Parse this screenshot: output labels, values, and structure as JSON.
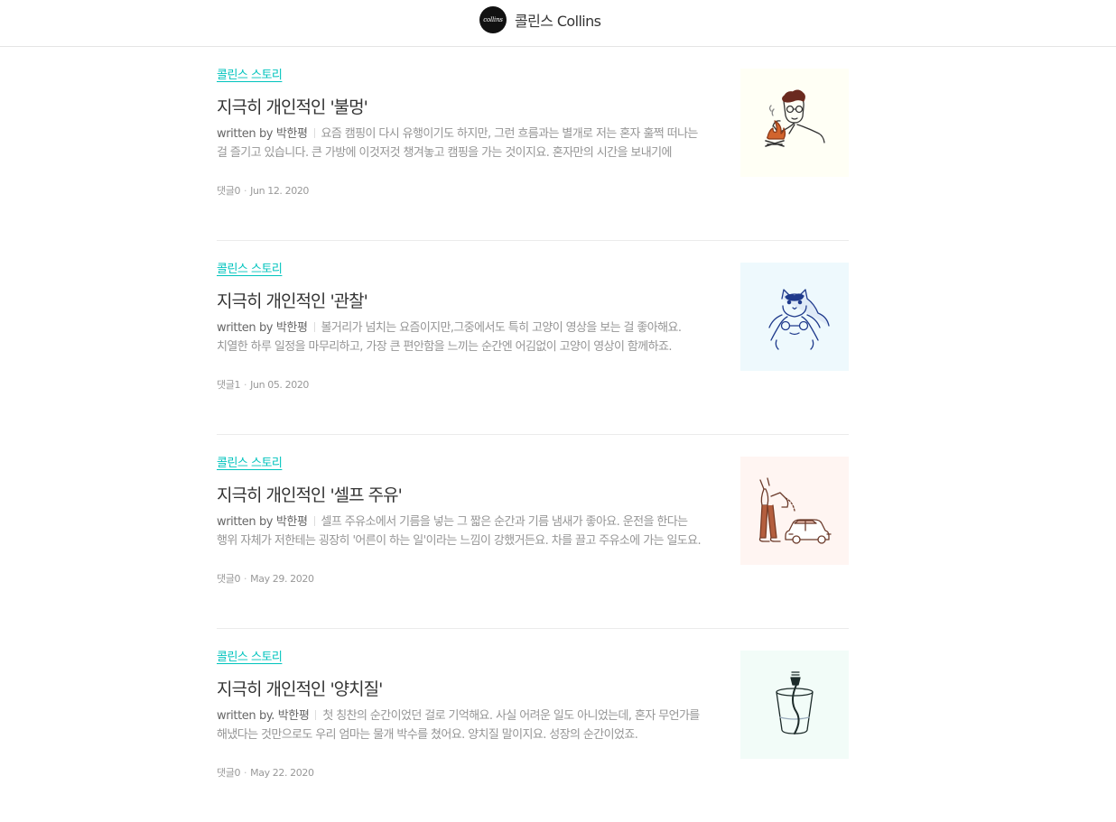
{
  "header": {
    "logo_text": "collins",
    "brand_name": "콜린스 Collins"
  },
  "posts": [
    {
      "category": "콜린스 스토리",
      "title": "지극히 개인적인 '불멍'",
      "author": "written by 박한평",
      "summary": "요즘 캠핑이 다시 유행이기도 하지만, 그런 흐름과는 별개로 저는 혼자 훌쩍 떠나는 걸 즐기고 있습니다. 큰 가방에 이것저것 챙겨놓고 캠핑을 가는 것이지요. 혼자만의 시간을 보내기에 이만한 게 없거든요.",
      "comments": "댓글0",
      "date": "Jun 12. 2020",
      "thumb_bg": "#fffff5",
      "thumb_icon": "campfire-person-illustration"
    },
    {
      "category": "콜린스 스토리",
      "title": "지극히 개인적인 '관찰'",
      "author": "written by 박한평",
      "summary": "볼거리가 넘치는 요즘이지만,그중에서도 특히 고양이 영상을 보는 걸 좋아해요. 치열한 하루 일정을 마무리하고, 가장 큰 편안함을 느끼는 순간엔 어김없이 고양이 영상이 함께하죠.",
      "comments": "댓글1",
      "date": "Jun 05. 2020",
      "thumb_bg": "#eef9fd",
      "thumb_icon": "cat-on-head-illustration"
    },
    {
      "category": "콜린스 스토리",
      "title": "지극히 개인적인 '셀프 주유'",
      "author": "written by 박한평",
      "summary": "셀프 주유소에서 기름을 넣는 그 짧은 순간과 기름 냄새가 좋아요. 운전을 한다는 행위 자체가 저한테는 굉장히 '어른이 하는 일'이라는 느낌이 강했거든요. 차를 끌고 주유소에 가는 일도요.",
      "comments": "댓글0",
      "date": "May 29. 2020",
      "thumb_bg": "#fff5f2",
      "thumb_icon": "fueling-car-illustration"
    },
    {
      "category": "콜린스 스토리",
      "title": "지극히 개인적인 '양치질'",
      "author": "written by. 박한평",
      "summary": "첫 칭찬의 순간이었던 걸로 기억해요. 사실 어려운 일도 아니었는데, 혼자 무언가를 해냈다는 것만으로도 우리 엄마는 물개 박수를 쳤어요. 양치질 말이지요. 성장의 순간이었죠.",
      "comments": "댓글0",
      "date": "May 22. 2020",
      "thumb_bg": "#f2fcf8",
      "thumb_icon": "toothbrush-cup-illustration"
    }
  ]
}
